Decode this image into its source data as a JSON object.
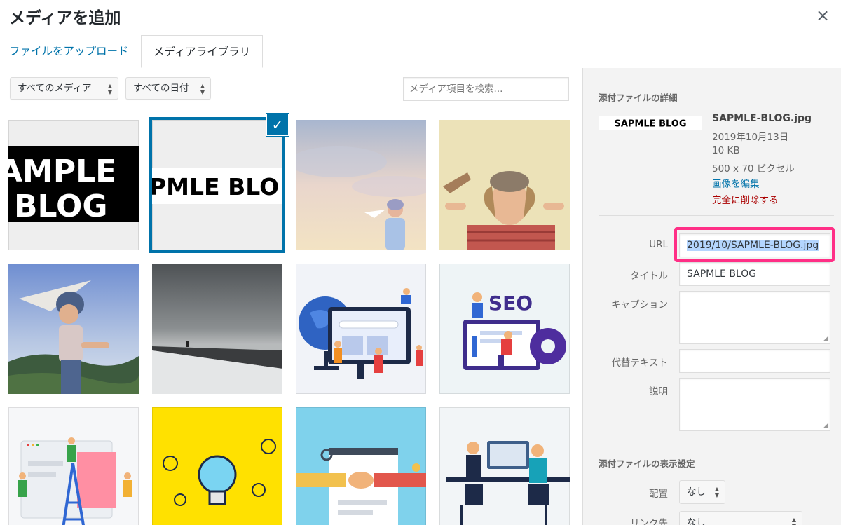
{
  "modal": {
    "title": "メディアを追加",
    "close_label": "×"
  },
  "tabs": [
    {
      "label": "ファイルをアップロード",
      "active": false
    },
    {
      "label": "メディアライブラリ",
      "active": true
    }
  ],
  "toolbar": {
    "type_filter": "すべてのメディア",
    "date_filter": "すべての日付",
    "search_placeholder": "メディア項目を検索..."
  },
  "grid": {
    "items": [
      {
        "kind": "sample-blog-logo",
        "text1": "AMPLE",
        "text2": "BLOG",
        "selected": false
      },
      {
        "kind": "sample-blog-banner",
        "text": "PMLE BLO",
        "selected": true
      },
      {
        "kind": "photo-child-paper-plane-sky",
        "selected": false
      },
      {
        "kind": "photo-child-toy-airplane",
        "selected": false
      },
      {
        "kind": "photo-boy-paper-plane",
        "selected": false
      },
      {
        "kind": "photo-stormy-beach",
        "selected": false
      },
      {
        "kind": "illustration-globe-web",
        "selected": false
      },
      {
        "kind": "illustration-seo",
        "text": "SEO",
        "selected": false
      },
      {
        "kind": "illustration-ladder-ui",
        "selected": false
      },
      {
        "kind": "illustration-lightbulbs",
        "selected": false
      },
      {
        "kind": "illustration-handshake",
        "selected": false
      },
      {
        "kind": "illustration-office-desk",
        "selected": false
      }
    ]
  },
  "details": {
    "heading": "添付ファイルの詳細",
    "thumb_text": "SAPMLE BLOG",
    "filename": "SAPMLE-BLOG.jpg",
    "date": "2019年10月13日",
    "size": "10 KB",
    "dimensions": "500 x 70 ピクセル",
    "edit_link": "画像を編集",
    "delete_link": "完全に削除する"
  },
  "fields": {
    "url_label": "URL",
    "url_value": "2019/10/SAPMLE-BLOG.jpg",
    "title_label": "タイトル",
    "title_value": "SAPMLE BLOG",
    "caption_label": "キャプション",
    "alt_label": "代替テキスト",
    "desc_label": "説明"
  },
  "display_settings": {
    "heading": "添付ファイルの表示設定",
    "align_label": "配置",
    "align_value": "なし",
    "link_label": "リンク先",
    "link_value": "なし"
  },
  "colors": {
    "accent": "#0073aa",
    "highlight": "#ff2f86",
    "delete": "#aa0000"
  }
}
